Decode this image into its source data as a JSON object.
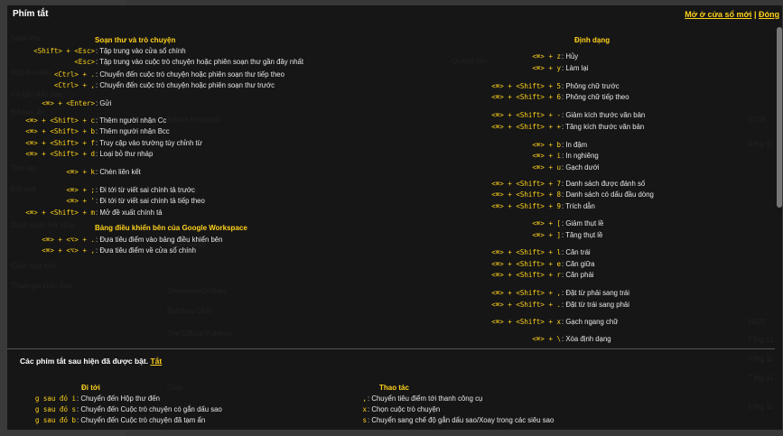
{
  "header": {
    "title": "Phím tắt",
    "open_new_window": "Mở ở cửa sổ mới",
    "separator": "|",
    "close": "Đóng"
  },
  "sections": {
    "compose": "Soạn thư và trò chuyện",
    "workspace": "Bảng điều khiển bên của Google Workspace",
    "format": "Định dạng",
    "enabled_note_text": "Các phím tắt sau hiện đã được bật.",
    "enabled_note_link": "Tắt",
    "goto": "Đi tới",
    "actions": "Thao tác"
  },
  "compose_shortcuts": [
    {
      "keys": "<Shift> + <Esc>",
      "desc": ": Tập trung vào cửa sổ chính"
    },
    {
      "keys": "<Esc>",
      "desc": ": Tập trung vào cuộc trò chuyện hoặc phiên soạn thư gần đây nhất"
    },
    {
      "keys": "<Ctrl> + .",
      "desc": ": Chuyển đến cuộc trò chuyện hoặc phiên soạn thư tiếp theo"
    },
    {
      "keys": "<Ctrl> + ,",
      "desc": ": Chuyển đến cuộc trò chuyện hoặc phiên soạn thư trước"
    },
    {
      "keys": "<⌘> + <Enter>",
      "desc": ": Gửi"
    },
    {
      "keys": "<⌘> + <Shift> + c",
      "desc": ": Thêm người nhận Cc"
    },
    {
      "keys": "<⌘> + <Shift> + b",
      "desc": ": Thêm người nhận Bcc"
    },
    {
      "keys": "<⌘> + <Shift> + f",
      "desc": ": Truy cập vào trường tùy chỉnh từ"
    },
    {
      "keys": "<⌘> + <Shift> + d",
      "desc": ": Loại bỏ thư nháp"
    },
    {
      "keys": "<⌘> + k",
      "desc": ": Chèn liên kết"
    },
    {
      "keys": "<⌘> + ;",
      "desc": ": Đi tới từ viết sai chính tả trước"
    },
    {
      "keys": "<⌘> + '",
      "desc": ": Đi tới từ viết sai chính tả tiếp theo"
    },
    {
      "keys": "<⌘> + <Shift> + m",
      "desc": ": Mở đề xuất chính tả"
    }
  ],
  "workspace_shortcuts": [
    {
      "keys": "<⌘> + <⌥> + .",
      "desc": ": Đưa tiêu điểm vào bảng điều khiển bên"
    },
    {
      "keys": "<⌘> + <⌥> + ,",
      "desc": ": Đưa tiêu điểm về cửa sổ chính"
    }
  ],
  "format_shortcuts": [
    {
      "keys": "<⌘> + z",
      "desc": ": Hủy"
    },
    {
      "keys": "<⌘> + y",
      "desc": ": Làm lại"
    },
    {
      "keys": "<⌘> + <Shift> + 5",
      "desc": ": Phông chữ trước"
    },
    {
      "keys": "<⌘> + <Shift> + 6",
      "desc": ": Phông chữ tiếp theo"
    },
    {
      "keys": "<⌘> + <Shift> + -",
      "desc": ": Giảm kích thước văn bản"
    },
    {
      "keys": "<⌘> + <Shift> + +",
      "desc": ": Tăng kích thước văn bản"
    },
    {
      "keys": "<⌘> + b",
      "desc": ": In đậm"
    },
    {
      "keys": "<⌘> + i",
      "desc": ": In nghiêng"
    },
    {
      "keys": "<⌘> + u",
      "desc": ": Gạch dưới"
    },
    {
      "keys": "<⌘> + <Shift> + 7",
      "desc": ": Danh sách được đánh số"
    },
    {
      "keys": "<⌘> + <Shift> + 8",
      "desc": ": Danh sách có dấu đầu dòng"
    },
    {
      "keys": "<⌘> + <Shift> + 9",
      "desc": ": Trích dẫn"
    },
    {
      "keys": "<⌘> + [",
      "desc": ": Giảm thụt lề"
    },
    {
      "keys": "<⌘> + ]",
      "desc": ": Tăng thụt lề"
    },
    {
      "keys": "<⌘> + <Shift> + l",
      "desc": ": Căn trái"
    },
    {
      "keys": "<⌘> + <Shift> + e",
      "desc": ": Căn giữa"
    },
    {
      "keys": "<⌘> + <Shift> + r",
      "desc": ": Căn phải"
    },
    {
      "keys": "<⌘> + <Shift> + ,",
      "desc": ": Đặt từ phải sang trái"
    },
    {
      "keys": "<⌘> + <Shift> + .",
      "desc": ": Đặt từ trái sang phải"
    },
    {
      "keys": "<⌘> + <Shift> + x",
      "desc": ": Gạch ngang chữ"
    },
    {
      "keys": "<⌘> + \\",
      "desc": ": Xóa định dạng"
    }
  ],
  "goto_shortcuts": [
    {
      "keys": "g sau đó i",
      "desc": ": Chuyển đến Hộp thư đến"
    },
    {
      "keys": "g sau đó s",
      "desc": ": Chuyển đến Cuộc trò chuyện có gắn dấu sao"
    },
    {
      "keys": "g sau đó b",
      "desc": ": Chuyển đến Cuộc trò chuyện đã tạm ẩn"
    }
  ],
  "action_shortcuts": [
    {
      "keys": ",",
      "desc": ": Chuyển tiêu điểm tới thanh công cụ"
    },
    {
      "keys": "x",
      "desc": ": Chọn cuộc trò chuyện"
    },
    {
      "keys": "s",
      "desc": ": Chuyển sang chế độ gắn dấu sao/Xoay trong các siêu sao"
    }
  ],
  "background": {
    "sidebar": [
      "Soạn thư",
      "Hộp thư đến",
      "Có gắn dấu sao",
      "Đã tạm ẩn",
      "Thư rác",
      "Đối quá",
      "Danh sách mở rộng",
      "Cuộc họp mới",
      "Tham gia cuộc họp"
    ],
    "tab": "Quảng cáo",
    "senders": [
      "adidas Runtastic",
      "Sendo.vn",
      "Apple News",
      "SharewareOnSale",
      "Bamboo Club",
      "The Official Pokémo.",
      "Grab"
    ],
    "dates": [
      "07:06",
      "4 thg 11",
      "10:25",
      "7 thg 11",
      "7 thg 11",
      "7 thg 11",
      "6 thg 11"
    ]
  }
}
